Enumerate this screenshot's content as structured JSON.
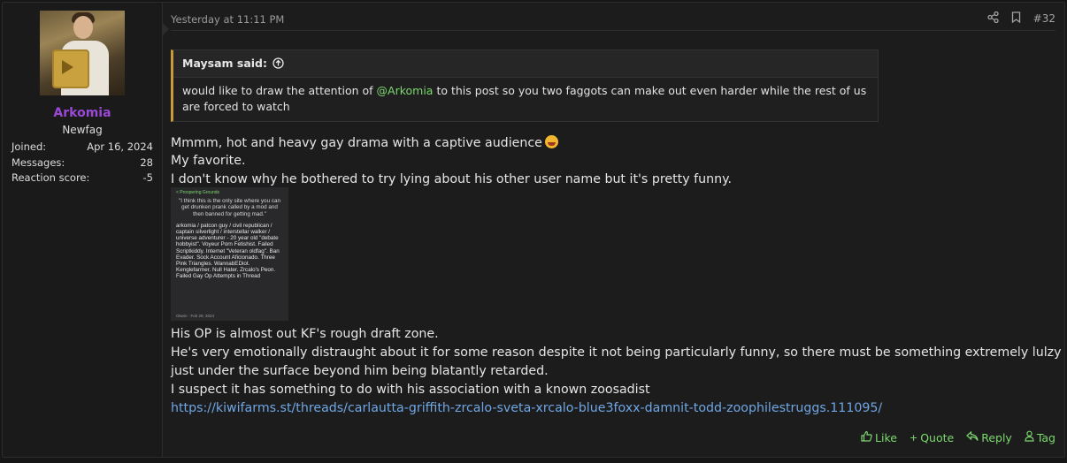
{
  "user": {
    "name": "Arkomia",
    "title": "Newfag",
    "stats": [
      {
        "label": "Joined:",
        "value": "Apr 16, 2024"
      },
      {
        "label": "Messages:",
        "value": "28"
      },
      {
        "label": "Reaction score:",
        "value": "-5"
      }
    ]
  },
  "post": {
    "date": "Yesterday at 11:11 PM",
    "number": "#32",
    "quote": {
      "author": "Maysam said:",
      "text_before": "would like to draw the attention of ",
      "mention": "@Arkomia",
      "text_after_line1": " to this post so you two faggots can make out even harder while the rest of us",
      "text_line2": "are forced to watch"
    },
    "lines": [
      "Mmmm, hot and heavy gay drama with a captive audience",
      "My favorite.",
      "I don't know why he bothered to try lying about his other user name but it's pretty funny."
    ],
    "lines_after": [
      "His OP is almost out KF's rough draft zone.",
      "He's very emotionally distraught about it for some reason despite it not being particularly funny, so there must be something extremely lulzy",
      "just under the surface beyond him being blatantly retarded.",
      "I suspect it has something to do with his association with a known zoosadist"
    ],
    "link": "https://kiwifarms.st/threads/carlautta-griffith-zrcalo-sveta-xrcalo-blue3foxx-damnit-todd-zoophilestruggs.111095/"
  },
  "attachment": {
    "header": "< Prospering Grounds",
    "quote": "\"I think this is the only site where you can get drunken prank called by a mod and then banned for getting mad.\"",
    "body": "arkomia / patcon guy / civil republican / captain silverlight / interstellar walker / universe adventurer - 20 year old \"debate hobbyist\". Voyeur Porn Fetishist. Failed Scriptkiddy. Internet \"Veteran oldfag\". Ban Evader. Sock Account Aficionado. Three Pink Triangles. WannabEDiot. Kenglefarmer. Null Hater. Zrcalo's Peon. Failed Gay Op Attempts in Thread",
    "footer": "Okwin · Feb 29, 2024"
  },
  "actions": {
    "like": "Like",
    "quote": "Quote",
    "reply": "Reply",
    "tag": "Tag"
  },
  "icons": {
    "share": "share-icon",
    "bookmark": "bookmark-icon",
    "quote_up": "arrow-up-circle-icon",
    "like": "thumbs-up-icon",
    "quote_action": "plus-icon",
    "reply": "reply-icon",
    "tag": "user-tag-icon"
  },
  "colors": {
    "username": "#9a49d6",
    "accent_green": "#7cd86e",
    "link": "#6fa6e4",
    "quote_border": "#c99a36"
  }
}
